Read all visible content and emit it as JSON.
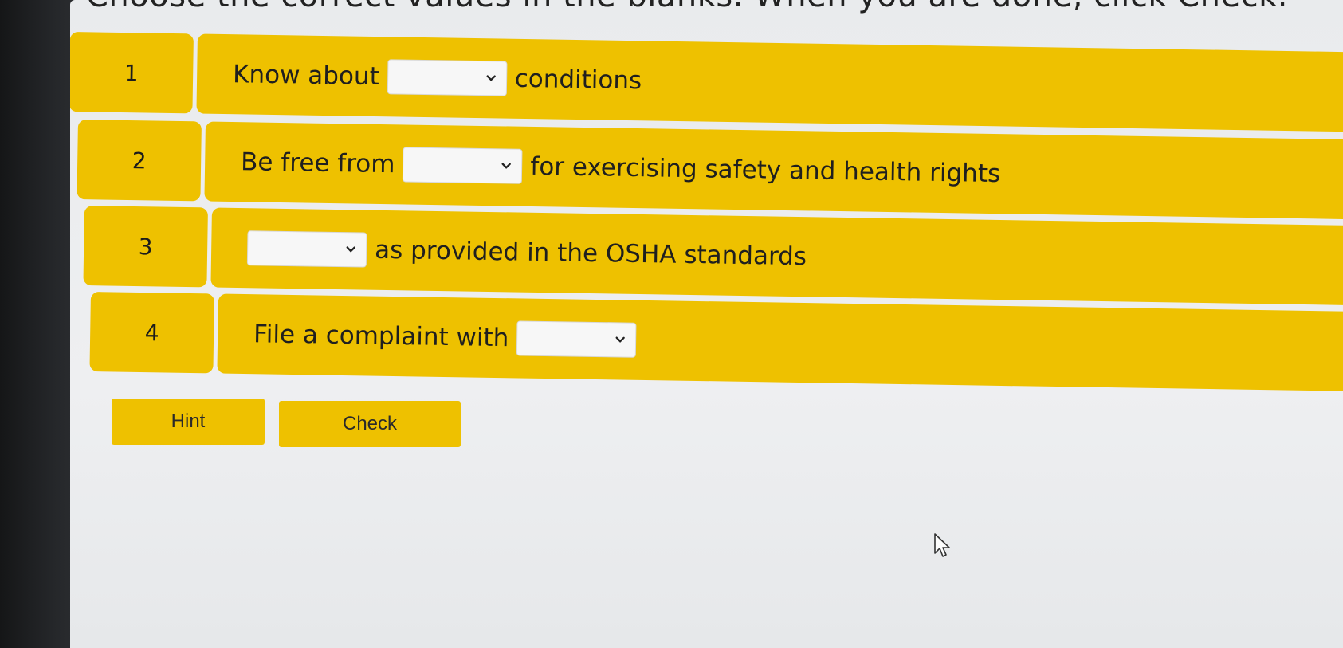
{
  "instruction": "Choose the correct values in the blanks. When you are done, click Check.",
  "rows": [
    {
      "number": "1",
      "before": "Know about",
      "after": "conditions",
      "selected": ""
    },
    {
      "number": "2",
      "before": "Be free from",
      "after": "for exercising safety and health rights",
      "selected": ""
    },
    {
      "number": "3",
      "before": "",
      "after": "as provided in the OSHA standards",
      "selected": ""
    },
    {
      "number": "4",
      "before": "File a complaint with",
      "after": "",
      "selected": ""
    }
  ],
  "buttons": {
    "hint": "Hint",
    "check": "Check"
  },
  "icons": {
    "dropdown": "chevron-down-icon",
    "cursor": "mouse-pointer-icon"
  },
  "colors": {
    "accent": "#eec100",
    "background": "#eceef0"
  }
}
